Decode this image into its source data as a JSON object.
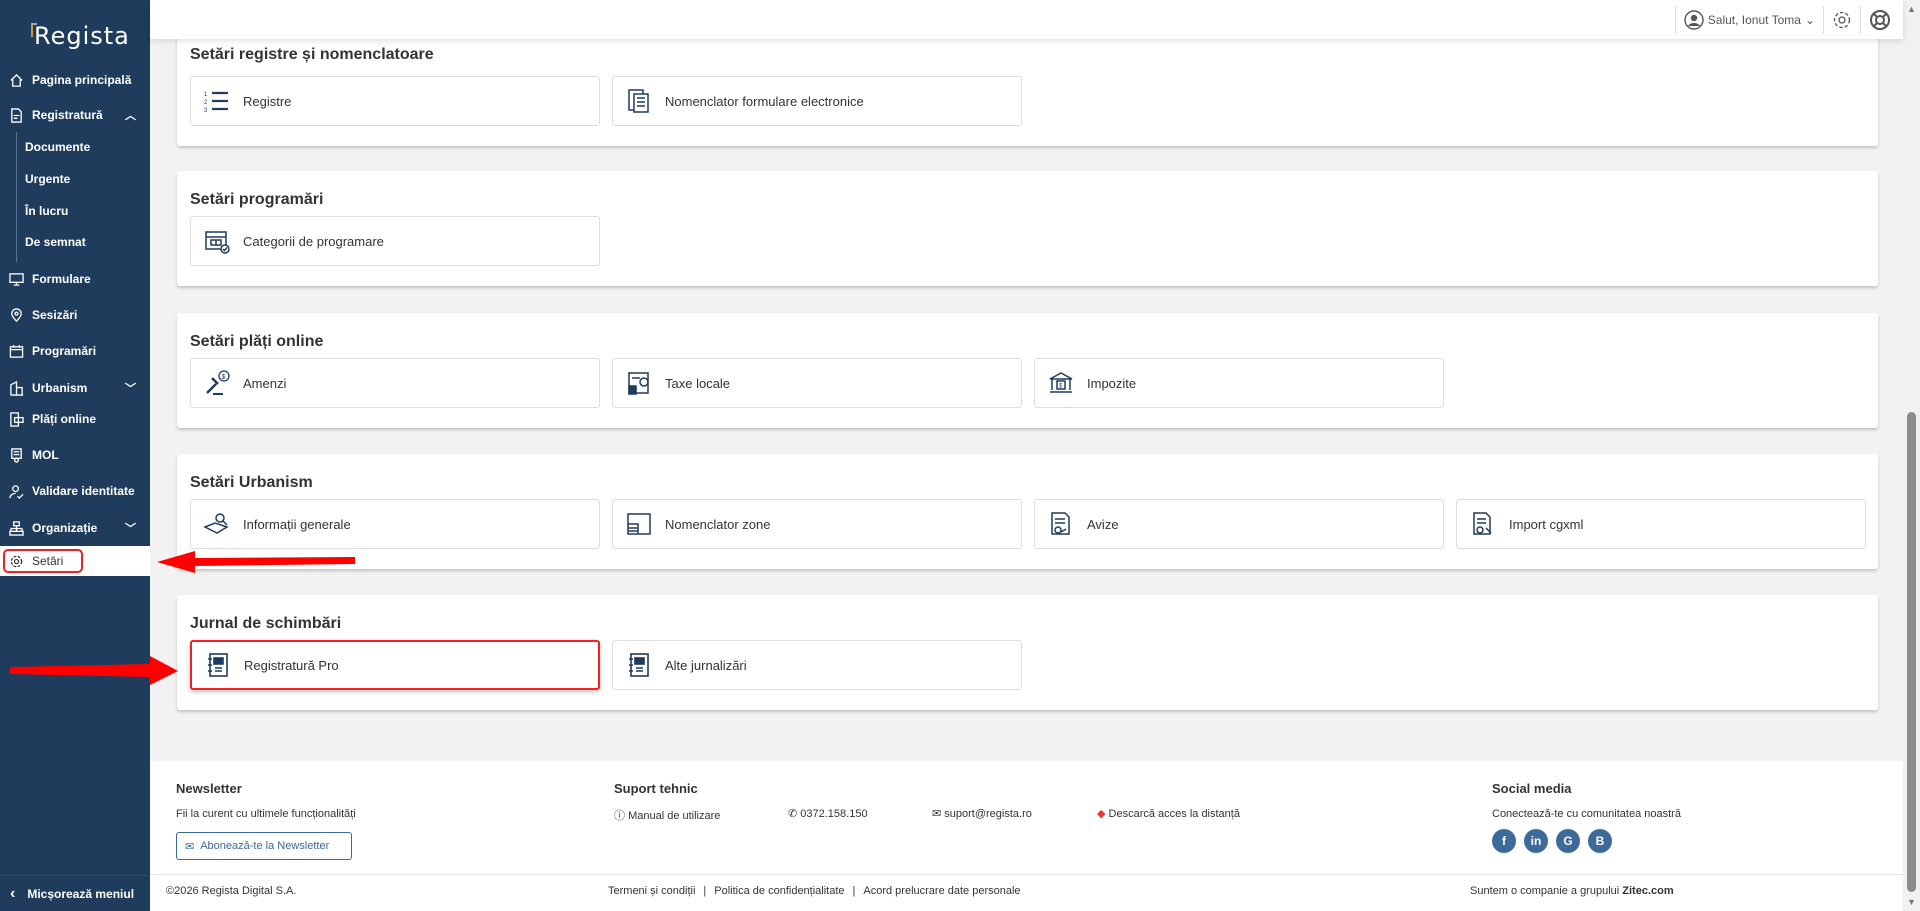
{
  "app": {
    "logo": "Regista"
  },
  "sidebar": {
    "items": [
      {
        "label": "Pagina principală"
      },
      {
        "label": "Registratură"
      },
      {
        "label": "Documente"
      },
      {
        "label": "Urgente"
      },
      {
        "label": "În lucru"
      },
      {
        "label": "De semnat"
      },
      {
        "label": "Formulare"
      },
      {
        "label": "Sesizări"
      },
      {
        "label": "Programări"
      },
      {
        "label": "Urbanism"
      },
      {
        "label": "Plăți online"
      },
      {
        "label": "MOL"
      },
      {
        "label": "Validare identitate"
      },
      {
        "label": "Organizație"
      },
      {
        "label": "Setări"
      }
    ],
    "collapse": "Micșorează meniul"
  },
  "header": {
    "greeting": "Salut, Ionut Toma"
  },
  "sections": [
    {
      "title": "Setări registre și nomenclatoare",
      "tiles": [
        {
          "label": "Registre",
          "icon": "numbered-list-icon"
        },
        {
          "label": "Nomenclator formulare electronice",
          "icon": "form-list-icon"
        }
      ]
    },
    {
      "title": "Setări programări",
      "tiles": [
        {
          "label": "Categorii de programare",
          "icon": "calendar-check-icon"
        }
      ]
    },
    {
      "title": "Setări plăți online",
      "tiles": [
        {
          "label": "Amenzi",
          "icon": "gavel-dollar-icon"
        },
        {
          "label": "Taxe locale",
          "icon": "tax-calculator-icon"
        },
        {
          "label": "Impozite",
          "icon": "bank-icon"
        }
      ]
    },
    {
      "title": "Setări Urbanism",
      "tiles": [
        {
          "label": "Informații generale",
          "icon": "map-search-icon"
        },
        {
          "label": "Nomenclator zone",
          "icon": "zones-icon"
        },
        {
          "label": "Avize",
          "icon": "document-approval-icon"
        },
        {
          "label": "Import cgxml",
          "icon": "file-import-icon"
        }
      ]
    },
    {
      "title": "Jurnal de schimbări",
      "tiles": [
        {
          "label": "Registratură Pro",
          "icon": "journal-icon"
        },
        {
          "label": "Alte jurnalizări",
          "icon": "journal-icon"
        }
      ]
    }
  ],
  "footer": {
    "newsletter": {
      "title": "Newsletter",
      "text": "Fii la curent cu ultimele funcționalități",
      "button": "Abonează-te la Newsletter"
    },
    "support": {
      "title": "Suport tehnic",
      "manual": "Manual de utilizare",
      "phone": "0372.158.150",
      "email": "suport@regista.ro",
      "remote": "Descarcă acces la distanță"
    },
    "social": {
      "title": "Social media",
      "text": "Conectează-te cu comunitatea noastră",
      "networks": [
        "f",
        "in",
        "G",
        "B"
      ]
    },
    "copyright": "©2026 Regista Digital S.A.",
    "links": [
      "Termeni și condiții",
      "Politica de confidențialitate",
      "Acord prelucrare date personale"
    ],
    "group_prefix": "Suntem o companie a grupului ",
    "group_name": "Zitec.com"
  },
  "colors": {
    "sidebar": "#1f3c5c",
    "accent": "#3d6a99",
    "highlight": "#e22222"
  }
}
